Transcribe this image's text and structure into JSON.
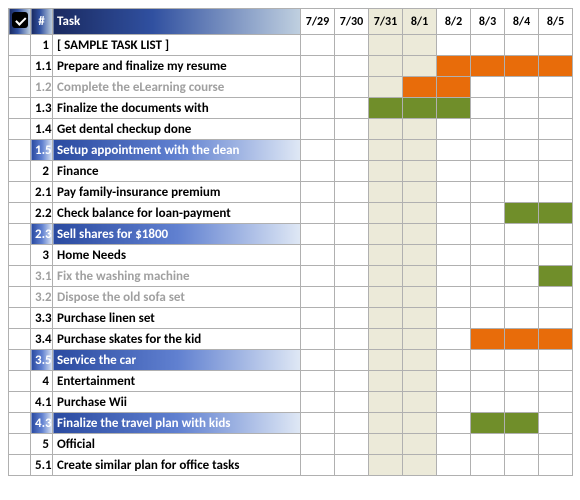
{
  "header": {
    "check": "✓",
    "num": "#",
    "task": "Task",
    "dates": [
      "7/29",
      "7/30",
      "7/31",
      "8/1",
      "8/2",
      "8/3",
      "8/4",
      "8/5"
    ]
  },
  "shaded_cols": [
    2,
    3
  ],
  "rows": [
    {
      "num": "1",
      "task": "[ SAMPLE TASK LIST ]",
      "bars": {}
    },
    {
      "num": "1.1",
      "task": "Prepare and finalize my resume",
      "bars": {
        "4": "orange",
        "5": "orange",
        "6": "orange",
        "7": "orange"
      }
    },
    {
      "num": "1.2",
      "task": "Complete the eLearning course",
      "completed": true,
      "bars": {
        "3": "orange",
        "4": "orange"
      }
    },
    {
      "num": "1.3",
      "task": "Finalize the documents with",
      "bars": {
        "2": "green",
        "3": "green",
        "4": "green"
      }
    },
    {
      "num": "1.4",
      "task": "Get dental checkup done",
      "bars": {}
    },
    {
      "num": "1.5",
      "task": "Setup appointment with the dean",
      "selected": true,
      "bars": {}
    },
    {
      "num": "2",
      "task": "Finance",
      "bars": {}
    },
    {
      "num": "2.1",
      "task": "Pay family-insurance premium",
      "bars": {}
    },
    {
      "num": "2.2",
      "task": "Check balance for loan-payment",
      "bars": {
        "6": "green",
        "7": "green"
      }
    },
    {
      "num": "2.3",
      "task": "Sell shares for $1800",
      "selected": true,
      "bars": {}
    },
    {
      "num": "3",
      "task": "Home Needs",
      "bars": {}
    },
    {
      "num": "3.1",
      "task": "Fix the washing machine",
      "completed": true,
      "bars": {
        "7": "green"
      }
    },
    {
      "num": "3.2",
      "task": "Dispose the old sofa set",
      "completed": true,
      "bars": {}
    },
    {
      "num": "3.3",
      "task": "Purchase linen set",
      "bars": {}
    },
    {
      "num": "3.4",
      "task": "Purchase skates for the kid",
      "bars": {
        "5": "orange",
        "6": "orange",
        "7": "orange"
      }
    },
    {
      "num": "3.5",
      "task": "Service the car",
      "selected": true,
      "bars": {}
    },
    {
      "num": "4",
      "task": "Entertainment",
      "bars": {}
    },
    {
      "num": "4.1",
      "task": "Purchase Wii",
      "bars": {}
    },
    {
      "num": "4.3",
      "task": "Finalize the travel plan with kids",
      "selected": true,
      "bars": {
        "5": "green",
        "6": "green"
      }
    },
    {
      "num": "5",
      "task": "Official",
      "bars": {}
    },
    {
      "num": "5.1",
      "task": "Create similar plan for office tasks",
      "bars": {}
    }
  ]
}
